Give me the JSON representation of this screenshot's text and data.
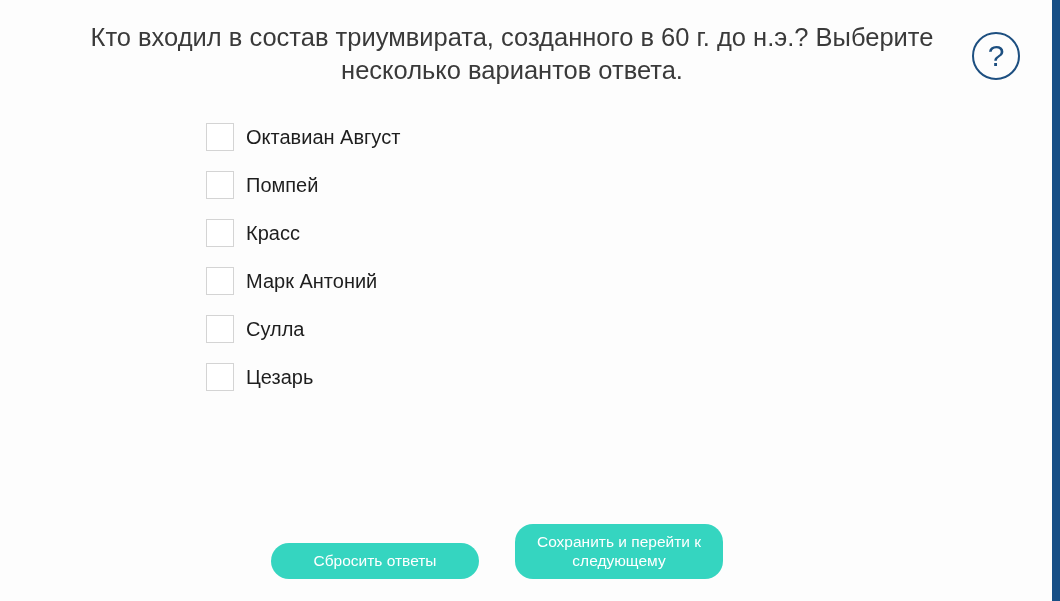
{
  "question": "Кто входил в состав триумвирата, созданного в 60 г. до н.э.? Выберите несколько вариантов ответа.",
  "help_button": {
    "label": "?"
  },
  "options": [
    {
      "label": "Октавиан Август",
      "checked": false
    },
    {
      "label": "Помпей",
      "checked": false
    },
    {
      "label": "Красс",
      "checked": false
    },
    {
      "label": "Марк Антоний",
      "checked": false
    },
    {
      "label": "Сулла",
      "checked": false
    },
    {
      "label": "Цезарь",
      "checked": false
    }
  ],
  "buttons": [
    {
      "label": "Сбросить ответы"
    },
    {
      "label": "Сохранить и перейти к следующему"
    }
  ]
}
